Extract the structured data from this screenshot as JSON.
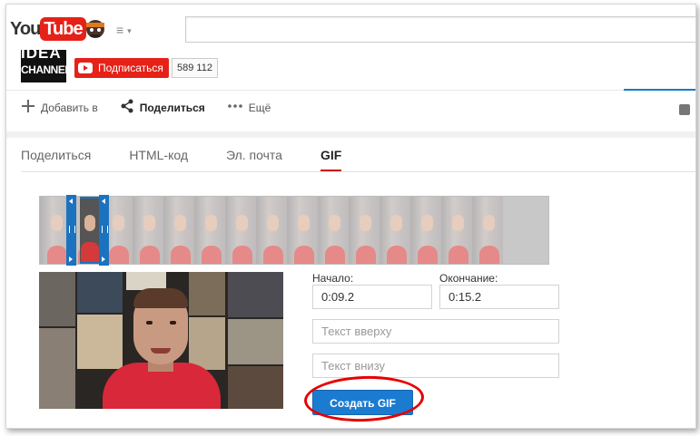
{
  "masthead": {
    "logo_you": "You",
    "logo_tube": "Tube",
    "search_placeholder": ""
  },
  "channel": {
    "logo_line1": "IDEA",
    "logo_line2": "CHANNEL",
    "subscribe_label": "Подписаться",
    "subscriber_count": "589 112"
  },
  "actions": [
    {
      "icon": "plus-icon",
      "label": "Добавить в"
    },
    {
      "icon": "share-icon",
      "label": "Поделиться"
    },
    {
      "icon": "more-icon",
      "label": "Ещё"
    }
  ],
  "tabs": [
    {
      "label": "Поделиться",
      "active": false
    },
    {
      "label": "HTML-код",
      "active": false
    },
    {
      "label": "Эл. почта",
      "active": false
    },
    {
      "label": "GIF",
      "active": true
    }
  ],
  "gif_form": {
    "start_label": "Начало:",
    "start_value": "0:09.2",
    "end_label": "Окончание:",
    "end_value": "0:15.2",
    "top_text_placeholder": "Текст вверху",
    "bottom_text_placeholder": "Текст внизу",
    "create_button": "Создать GIF"
  },
  "colors": {
    "youtube_red": "#e62117",
    "accent_blue": "#1b7bd1",
    "highlight_ring": "#e60000"
  }
}
